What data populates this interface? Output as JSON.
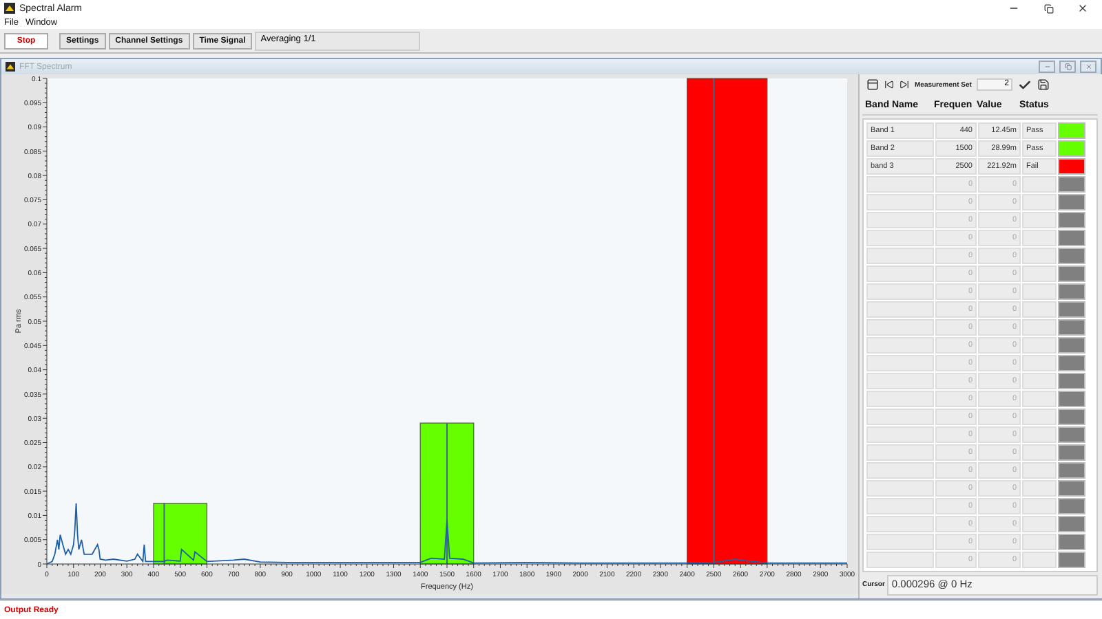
{
  "window": {
    "title": "Spectral Alarm"
  },
  "menu": [
    "File",
    "Window"
  ],
  "toolbar": {
    "buttons": [
      {
        "label": "Stop",
        "kind": "stop"
      },
      {
        "label": "Settings",
        "kind": "normal"
      },
      {
        "label": "Channel Settings",
        "kind": "normal"
      },
      {
        "label": "Time Signal",
        "kind": "normal"
      }
    ],
    "status": "Averaging 1/1"
  },
  "subwindow": {
    "title": "FFT Spectrum"
  },
  "chart_data": {
    "type": "line",
    "xlabel": "Frequency (Hz)",
    "ylabel": "Pa rms",
    "xlim": [
      0,
      3000
    ],
    "ylim": [
      0,
      0.1
    ],
    "xticks": [
      0,
      100,
      200,
      300,
      400,
      500,
      600,
      700,
      800,
      900,
      1000,
      1100,
      1200,
      1300,
      1400,
      1500,
      1600,
      1700,
      1800,
      1900,
      2000,
      2100,
      2200,
      2300,
      2400,
      2500,
      2600,
      2700,
      2800,
      2900,
      3000
    ],
    "yticks": [
      0,
      0.005,
      0.01,
      0.015,
      0.02,
      0.025,
      0.03,
      0.035,
      0.04,
      0.045,
      0.05,
      0.055,
      0.06,
      0.065,
      0.07,
      0.075,
      0.08,
      0.085,
      0.09,
      0.095,
      0.1
    ],
    "series": [
      {
        "color": "#1f5fa8",
        "x": [
          0,
          20,
          30,
          40,
          45,
          50,
          60,
          70,
          80,
          90,
          100,
          105,
          110,
          115,
          120,
          130,
          140,
          150,
          170,
          190,
          195,
          200,
          220,
          250,
          300,
          330,
          340,
          360,
          365,
          370,
          400,
          440,
          450,
          500,
          505,
          550,
          555,
          600,
          700,
          740,
          800,
          900,
          1000,
          1200,
          1400,
          1440,
          1490,
          1500,
          1510,
          1560,
          1600,
          1800,
          2000,
          2400,
          2500,
          2580,
          2600,
          2700,
          2900,
          3000
        ],
        "values": [
          0,
          0.0005,
          0.002,
          0.005,
          0.003,
          0.006,
          0.004,
          0.002,
          0.003,
          0.002,
          0.004,
          0.007,
          0.0125,
          0.006,
          0.003,
          0.005,
          0.002,
          0.002,
          0.002,
          0.004,
          0.003,
          0.001,
          0.0008,
          0.001,
          0.0006,
          0.001,
          0.002,
          0.0005,
          0.004,
          0.0005,
          0.0005,
          0.0005,
          0.0008,
          0.0006,
          0.003,
          0.0008,
          0.0025,
          0.0005,
          0.0008,
          0.001,
          0.0004,
          0.0003,
          0.0003,
          0.0003,
          0.0003,
          0.0012,
          0.001,
          0.009,
          0.0012,
          0.001,
          0.0002,
          0.0003,
          0.0002,
          0.0002,
          0.0003,
          0.001,
          0.0008,
          0.0002,
          0.0002,
          0.0002
        ]
      },
      {
        "type": "area",
        "color": "#66ff00",
        "x": [
          400,
          600
        ],
        "values": [
          0.0125,
          0.0125
        ]
      },
      {
        "type": "area",
        "color": "#66ff00",
        "x": [
          1400,
          1600
        ],
        "values": [
          0.029,
          0.029
        ]
      },
      {
        "type": "area",
        "color": "#ff0000",
        "x": [
          2400,
          2700
        ],
        "values": [
          0.1,
          0.1
        ]
      }
    ],
    "ref_lines": [
      {
        "axis": "x",
        "value": 440,
        "color": "#3d6a8a"
      },
      {
        "axis": "x",
        "value": 1500,
        "color": "#3d6a8a"
      },
      {
        "axis": "x",
        "value": 2500,
        "color": "#3d6a8a"
      }
    ]
  },
  "measurement": {
    "label": "Measurement Set",
    "value": "2"
  },
  "table": {
    "columns": [
      "Band Name",
      "Frequen",
      "Value",
      "Status"
    ],
    "rows": [
      {
        "name": "Band 1",
        "frequency": "440",
        "value": "12.45m",
        "status": "Pass",
        "color": "#66ff00"
      },
      {
        "name": "Band 2",
        "frequency": "1500",
        "value": "28.99m",
        "status": "Pass",
        "color": "#66ff00"
      },
      {
        "name": "band 3",
        "frequency": "2500",
        "value": "221.92m",
        "status": "Fail",
        "color": "#ff0000"
      },
      {
        "frequency": "0",
        "value": "0",
        "color": "#808080"
      },
      {
        "frequency": "0",
        "value": "0",
        "color": "#808080"
      },
      {
        "frequency": "0",
        "value": "0",
        "color": "#808080"
      },
      {
        "frequency": "0",
        "value": "0",
        "color": "#808080"
      },
      {
        "frequency": "0",
        "value": "0",
        "color": "#808080"
      },
      {
        "frequency": "0",
        "value": "0",
        "color": "#808080"
      },
      {
        "frequency": "0",
        "value": "0",
        "color": "#808080"
      },
      {
        "frequency": "0",
        "value": "0",
        "color": "#808080"
      },
      {
        "frequency": "0",
        "value": "0",
        "color": "#808080"
      },
      {
        "frequency": "0",
        "value": "0",
        "color": "#808080"
      },
      {
        "frequency": "0",
        "value": "0",
        "color": "#808080"
      },
      {
        "frequency": "0",
        "value": "0",
        "color": "#808080"
      },
      {
        "frequency": "0",
        "value": "0",
        "color": "#808080"
      },
      {
        "frequency": "0",
        "value": "0",
        "color": "#808080"
      },
      {
        "frequency": "0",
        "value": "0",
        "color": "#808080"
      },
      {
        "frequency": "0",
        "value": "0",
        "color": "#808080"
      },
      {
        "frequency": "0",
        "value": "0",
        "color": "#808080"
      },
      {
        "frequency": "0",
        "value": "0",
        "color": "#808080"
      },
      {
        "frequency": "0",
        "value": "0",
        "color": "#808080"
      },
      {
        "frequency": "0",
        "value": "0",
        "color": "#808080"
      },
      {
        "frequency": "0",
        "value": "0",
        "color": "#808080"
      },
      {
        "frequency": "0",
        "value": "0",
        "color": "#808080"
      }
    ]
  },
  "cursor": {
    "label": "Cursor",
    "value": "0.000296 @ 0 Hz"
  },
  "status_bar": "Output Ready"
}
